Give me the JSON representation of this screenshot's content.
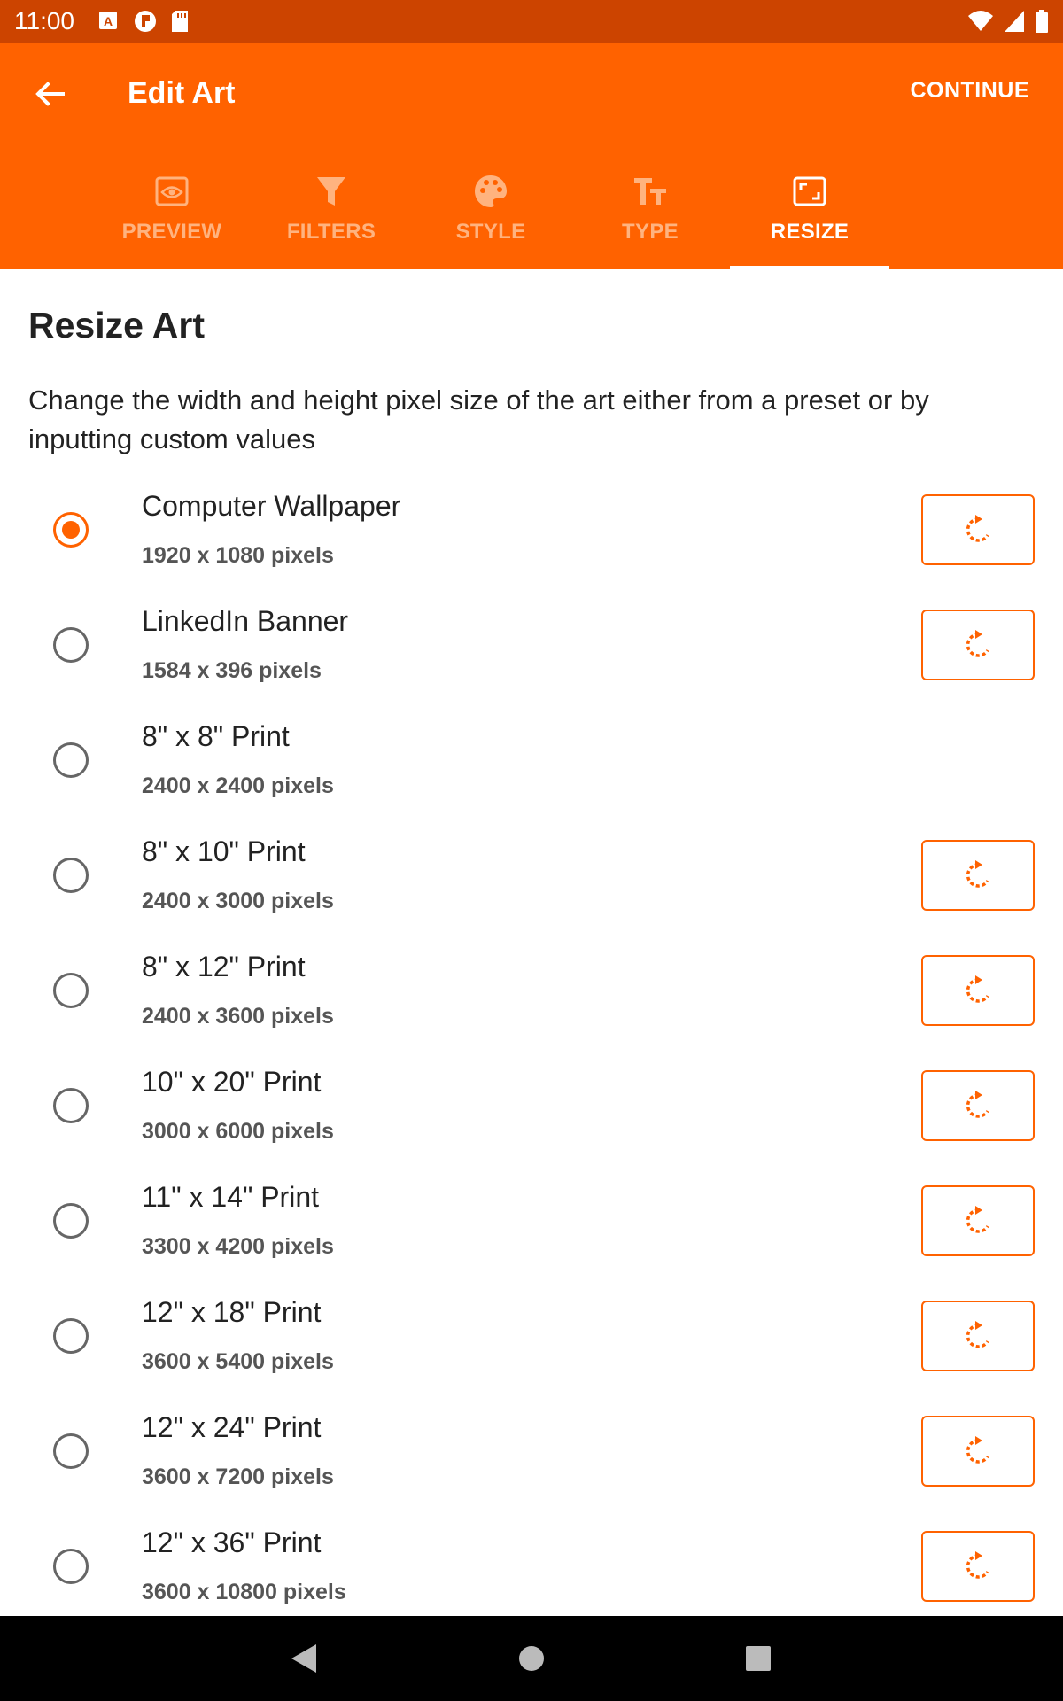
{
  "status_bar": {
    "time": "11:00"
  },
  "app_bar": {
    "title": "Edit Art",
    "continue_label": "CONTINUE"
  },
  "tabs": [
    {
      "label": "PREVIEW",
      "icon": "preview-icon",
      "active": false
    },
    {
      "label": "FILTERS",
      "icon": "filter-icon",
      "active": false
    },
    {
      "label": "STYLE",
      "icon": "palette-icon",
      "active": false
    },
    {
      "label": "TYPE",
      "icon": "text-type-icon",
      "active": false
    },
    {
      "label": "RESIZE",
      "icon": "resize-icon",
      "active": true
    }
  ],
  "section": {
    "title": "Resize Art",
    "description": "Change the width and height pixel size of the art either from a preset or by inputting custom values"
  },
  "presets": [
    {
      "title": "Computer Wallpaper",
      "subtitle": "1920 x 1080 pixels",
      "selected": true,
      "has_apply": true
    },
    {
      "title": "LinkedIn Banner",
      "subtitle": "1584 x 396 pixels",
      "selected": false,
      "has_apply": true
    },
    {
      "title": "8\" x 8\" Print",
      "subtitle": "2400 x 2400 pixels",
      "selected": false,
      "has_apply": false
    },
    {
      "title": "8\" x 10\" Print",
      "subtitle": "2400 x 3000 pixels",
      "selected": false,
      "has_apply": true
    },
    {
      "title": "8\" x 12\" Print",
      "subtitle": "2400 x 3600 pixels",
      "selected": false,
      "has_apply": true
    },
    {
      "title": "10\" x 20\" Print",
      "subtitle": "3000 x 6000 pixels",
      "selected": false,
      "has_apply": true
    },
    {
      "title": "11\" x 14\" Print",
      "subtitle": "3300 x 4200 pixels",
      "selected": false,
      "has_apply": true
    },
    {
      "title": "12\" x 18\" Print",
      "subtitle": "3600 x 5400 pixels",
      "selected": false,
      "has_apply": true
    },
    {
      "title": "12\" x 24\" Print",
      "subtitle": "3600 x 7200 pixels",
      "selected": false,
      "has_apply": true
    },
    {
      "title": "12\" x 36\" Print",
      "subtitle": "3600 x 10800 pixels",
      "selected": false,
      "has_apply": true
    }
  ],
  "colors": {
    "primary": "#ff6200",
    "status_bar": "#cc4400",
    "inactive_tab": "#ffb37f"
  }
}
